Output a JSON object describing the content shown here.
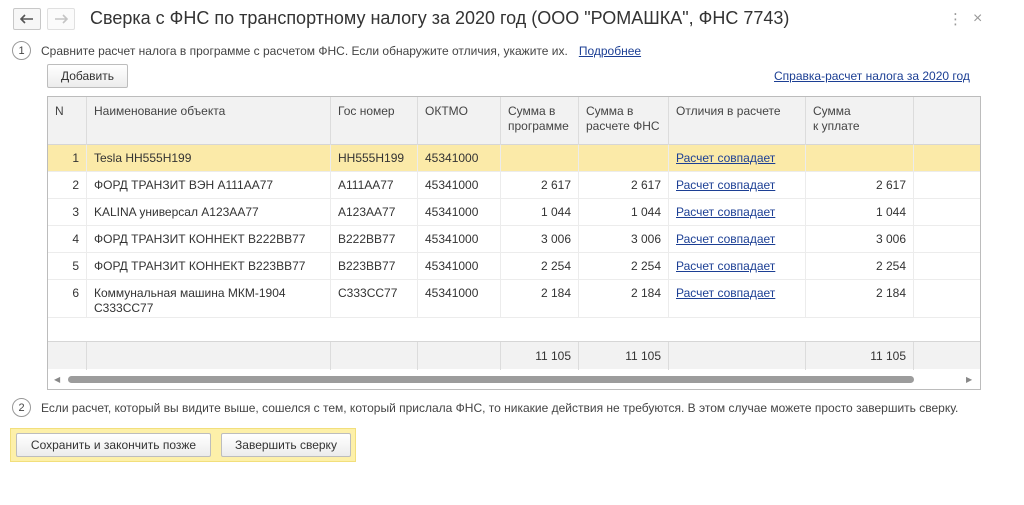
{
  "window": {
    "title": "Сверка с ФНС по транспортному налогу за 2020 год (ООО \"РОМАШКА\", ФНС 7743)",
    "more_icon": "more-vertical-icon",
    "close_icon": "close-icon"
  },
  "nav": {
    "back_icon": "back-arrow-icon",
    "forward_icon": "forward-arrow-icon"
  },
  "step1": {
    "number": "1",
    "text": "Сравните расчет налога в программе с расчетом ФНС. Если обнаружите отличия, укажите их.",
    "link": "Подробнее"
  },
  "toolbar": {
    "add_label": "Добавить",
    "report_link": "Справка-расчет налога за 2020 год"
  },
  "table": {
    "columns": {
      "n": "N",
      "name": "Наименование объекта",
      "plate": "Гос номер",
      "oktmo": "ОКТМО",
      "sum_program_1": "Сумма в",
      "sum_program_2": "программе",
      "sum_fns_1": "Сумма в",
      "sum_fns_2": "расчете ФНС",
      "diff": "Отличия в расчете",
      "pay_1": "Сумма",
      "pay_2": "к уплате"
    },
    "rows": [
      {
        "n": "1",
        "name": "Tesla НН555Н199",
        "name2": "",
        "plate": "НН555Н199",
        "oktmo": "45341000",
        "sum_program": "",
        "sum_fns": "",
        "diff": "Расчет совпадает",
        "pay": ""
      },
      {
        "n": "2",
        "name": "ФОРД ТРАНЗИТ ВЭН А111АА77",
        "name2": "",
        "plate": "А111АА77",
        "oktmo": "45341000",
        "sum_program": "2 617",
        "sum_fns": "2 617",
        "diff": "Расчет совпадает",
        "pay": "2 617"
      },
      {
        "n": "3",
        "name": "KALINA универсал А123АА77",
        "name2": "",
        "plate": "А123АА77",
        "oktmo": "45341000",
        "sum_program": "1 044",
        "sum_fns": "1 044",
        "diff": "Расчет совпадает",
        "pay": "1 044"
      },
      {
        "n": "4",
        "name": "ФОРД ТРАНЗИТ КОННЕКТ В222ВВ77",
        "name2": "",
        "plate": "В222ВВ77",
        "oktmo": "45341000",
        "sum_program": "3 006",
        "sum_fns": "3 006",
        "diff": "Расчет совпадает",
        "pay": "3 006"
      },
      {
        "n": "5",
        "name": "ФОРД ТРАНЗИТ КОННЕКТ В223ВВ77",
        "name2": "",
        "plate": "В223ВВ77",
        "oktmo": "45341000",
        "sum_program": "2 254",
        "sum_fns": "2 254",
        "diff": "Расчет совпадает",
        "pay": "2 254"
      },
      {
        "n": "6",
        "name": "Коммунальная машина МКМ-1904",
        "name2": "С333СС77",
        "plate": "С333СС77",
        "oktmo": "45341000",
        "sum_program": "2 184",
        "sum_fns": "2 184",
        "diff": "Расчет совпадает",
        "pay": "2 184"
      }
    ],
    "totals": {
      "sum_program": "11 105",
      "sum_fns": "11 105",
      "pay": "11 105"
    },
    "selected_row": 0
  },
  "step2": {
    "number": "2",
    "text": "Если расчет, который вы видите выше, сошелся с тем, который прислала ФНС, то никакие действия не требуются. В этом случае можете просто завершить сверку."
  },
  "actions": {
    "save_later": "Сохранить и закончить позже",
    "finish": "Завершить сверку"
  },
  "colors": {
    "selected_row": "#fbeaa8",
    "footer_highlight": "#fdf0a9",
    "link": "#1c3f94"
  }
}
